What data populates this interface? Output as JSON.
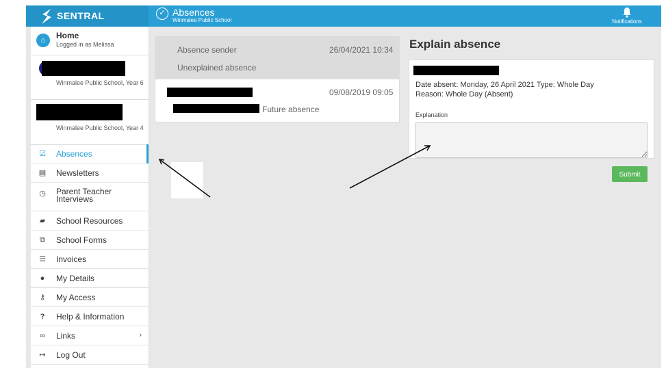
{
  "brand": {
    "name": "SENTRAL"
  },
  "header": {
    "title": "Absences",
    "subtitle": "Winmalee Public School"
  },
  "notifications": {
    "label": "Notifications",
    "icon": "bell-icon"
  },
  "sidebar": {
    "home": {
      "title": "Home",
      "subtitle": "Logged in as Melissa"
    },
    "students": [
      {
        "school": "Winmalee Public School, Year 6"
      },
      {
        "school": "Winmalee Public School, Year 4"
      }
    ],
    "items": [
      {
        "label": "Absences",
        "icon": "check-square-icon"
      },
      {
        "label": "Newsletters",
        "icon": "newspaper-icon"
      },
      {
        "label": "Parent Teacher Interviews",
        "icon": "clock-icon"
      },
      {
        "label": "School Resources",
        "icon": "folder-open-icon"
      },
      {
        "label": "School Forms",
        "icon": "copy-icon"
      },
      {
        "label": "Invoices",
        "icon": "list-icon"
      },
      {
        "label": "My Details",
        "icon": "user-icon"
      },
      {
        "label": "My Access",
        "icon": "key-icon"
      },
      {
        "label": "Help & Information",
        "icon": "question-icon"
      },
      {
        "label": "Links",
        "icon": "link-icon"
      },
      {
        "label": "Log Out",
        "icon": "sign-out-icon"
      }
    ]
  },
  "absences": [
    {
      "sender": "Absence sender",
      "datetime": "26/04/2021 10:34",
      "status": "Unexplained absence"
    },
    {
      "datetime": "09/08/2019 09:05",
      "status": "Future absence"
    }
  ],
  "explain": {
    "title": "Explain absence",
    "date_line": "Date absent: Monday, 26 April 2021 Type: Whole Day",
    "reason_line": "Reason: Whole Day (Absent)",
    "explanation_label": "Explanation",
    "explanation_value": "",
    "submit_label": "Submit"
  },
  "colors": {
    "accent": "#2a9fd6",
    "submit": "#5cb85c"
  }
}
